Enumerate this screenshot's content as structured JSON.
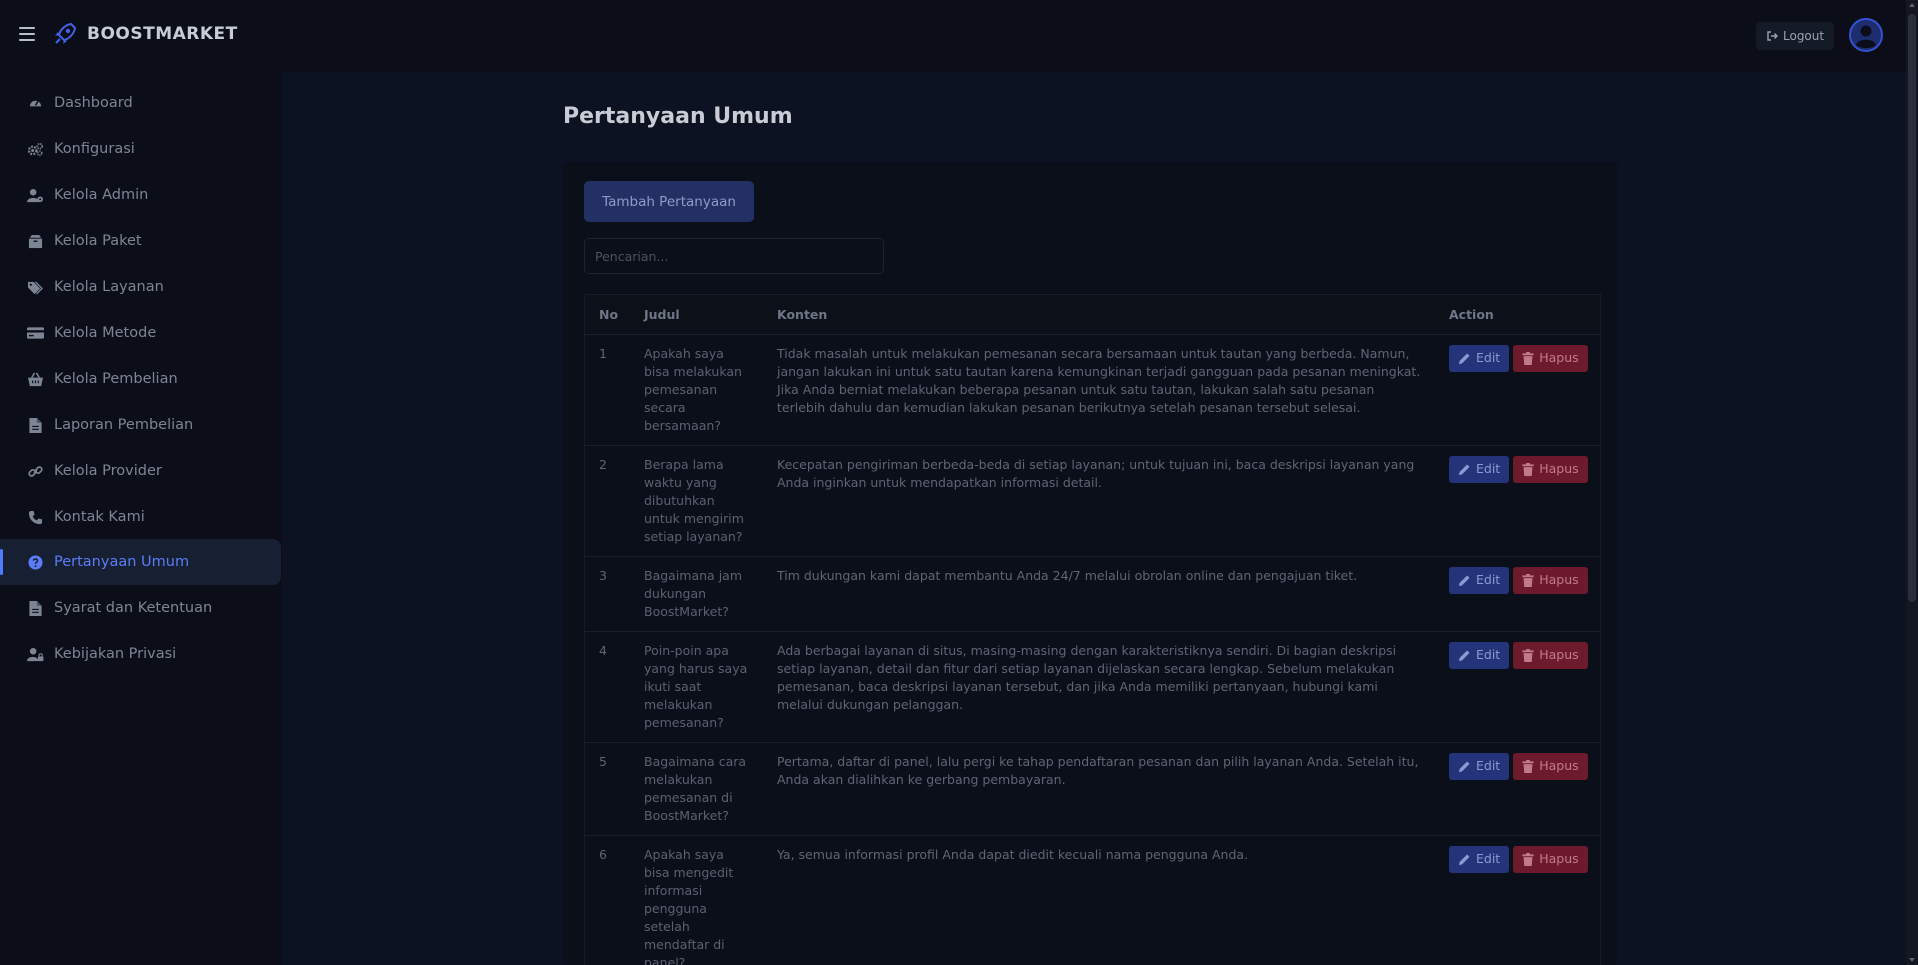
{
  "brand": {
    "name": "BOOSTMARKET"
  },
  "header": {
    "logout_label": "Logout"
  },
  "sidebar": {
    "items": [
      {
        "label": "Dashboard",
        "icon": "gauge-icon",
        "active": false
      },
      {
        "label": "Konfigurasi",
        "icon": "cogs-icon",
        "active": false
      },
      {
        "label": "Kelola Admin",
        "icon": "user-cog-icon",
        "active": false
      },
      {
        "label": "Kelola Paket",
        "icon": "box-icon",
        "active": false
      },
      {
        "label": "Kelola Layanan",
        "icon": "tags-icon",
        "active": false
      },
      {
        "label": "Kelola Metode",
        "icon": "credit-card-icon",
        "active": false
      },
      {
        "label": "Kelola Pembelian",
        "icon": "basket-icon",
        "active": false
      },
      {
        "label": "Laporan Pembelian",
        "icon": "file-icon",
        "active": false
      },
      {
        "label": "Kelola Provider",
        "icon": "link-icon",
        "active": false
      },
      {
        "label": "Kontak Kami",
        "icon": "phone-icon",
        "active": false
      },
      {
        "label": "Pertanyaan Umum",
        "icon": "question-circle-icon",
        "active": true
      },
      {
        "label": "Syarat dan Ketentuan",
        "icon": "file-icon",
        "active": false
      },
      {
        "label": "Kebijakan Privasi",
        "icon": "user-lock-icon",
        "active": false
      }
    ]
  },
  "main": {
    "title": "Pertanyaan Umum",
    "add_button": "Tambah Pertanyaan",
    "search": {
      "placeholder": "Pencarian...",
      "value": ""
    },
    "table": {
      "columns": [
        "No",
        "Judul",
        "Konten",
        "Action"
      ],
      "edit_label": "Edit",
      "delete_label": "Hapus",
      "rows": [
        {
          "no": "1",
          "judul": "Apakah saya bisa melakukan pemesanan secara bersamaan?",
          "konten": "Tidak masalah untuk melakukan pemesanan secara bersamaan untuk tautan yang berbeda. Namun, jangan lakukan ini untuk satu tautan karena kemungkinan terjadi gangguan pada pesanan meningkat. Jika Anda berniat melakukan beberapa pesanan untuk satu tautan, lakukan salah satu pesanan terlebih dahulu dan kemudian lakukan pesanan berikutnya setelah pesanan tersebut selesai."
        },
        {
          "no": "2",
          "judul": "Berapa lama waktu yang dibutuhkan untuk mengirim setiap layanan?",
          "konten": "Kecepatan pengiriman berbeda-beda di setiap layanan; untuk tujuan ini, baca deskripsi layanan yang Anda inginkan untuk mendapatkan informasi detail."
        },
        {
          "no": "3",
          "judul": "Bagaimana jam dukungan BoostMarket?",
          "konten": "Tim dukungan kami dapat membantu Anda 24/7 melalui obrolan online dan pengajuan tiket."
        },
        {
          "no": "4",
          "judul": "Poin-poin apa yang harus saya ikuti saat melakukan pemesanan?",
          "konten": "Ada berbagai layanan di situs, masing-masing dengan karakteristiknya sendiri. Di bagian deskripsi setiap layanan, detail dan fitur dari setiap layanan dijelaskan secara lengkap. Sebelum melakukan pemesanan, baca deskripsi layanan tersebut, dan jika Anda memiliki pertanyaan, hubungi kami melalui dukungan pelanggan."
        },
        {
          "no": "5",
          "judul": "Bagaimana cara melakukan pemesanan di BoostMarket?",
          "konten": "Pertama, daftar di panel, lalu pergi ke tahap pendaftaran pesanan dan pilih layanan Anda. Setelah itu, Anda akan dialihkan ke gerbang pembayaran."
        },
        {
          "no": "6",
          "judul": "Apakah saya bisa mengedit informasi pengguna setelah mendaftar di panel?",
          "konten": "Ya, semua informasi profil Anda dapat diedit kecuali nama pengguna Anda."
        }
      ]
    }
  }
}
